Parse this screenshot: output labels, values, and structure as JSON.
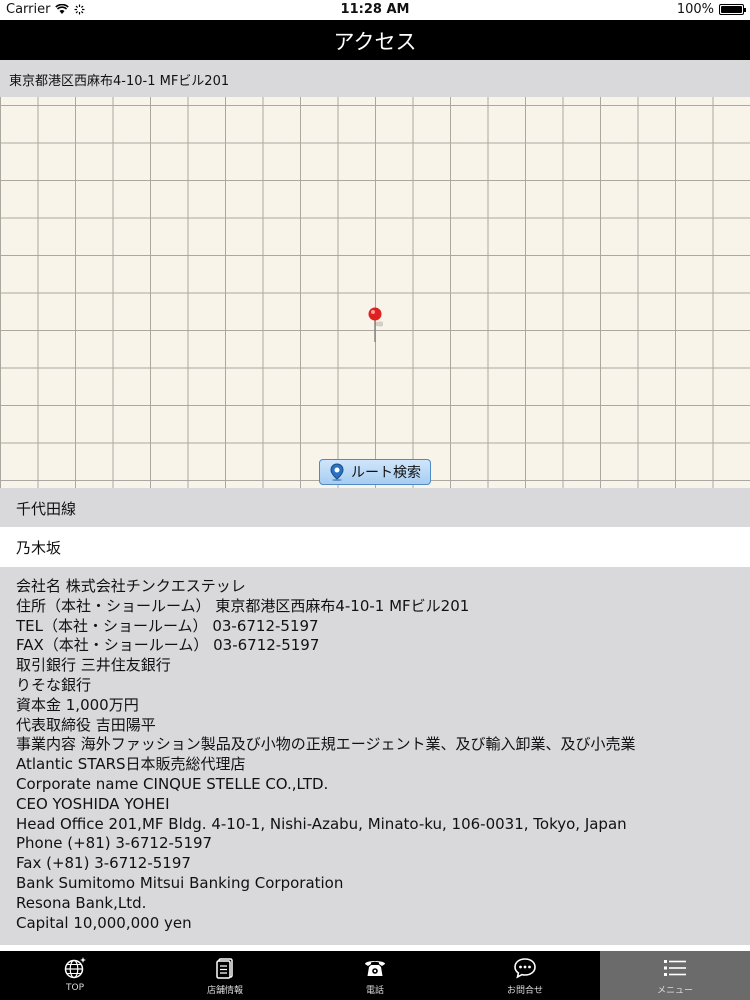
{
  "status_bar": {
    "carrier": "Carrier",
    "time": "11:28 AM",
    "battery": "100%",
    "battery_level": 1.0
  },
  "nav": {
    "title": "アクセス"
  },
  "address": {
    "text": "東京都港区西麻布4-10-1 MFビル201"
  },
  "map": {
    "route_button": "ルート検索"
  },
  "route": {
    "line": "千代田線",
    "station": "乃木坂"
  },
  "info_lines": [
    "会社名 株式会社チンクエステッレ",
    "住所（本社・ショールーム） 東京都港区西麻布4-10-1 MFビル201",
    "TEL（本社・ショールーム） 03-6712-5197",
    "FAX（本社・ショールーム） 03-6712-5197",
    "取引銀行 三井住友銀行",
    "りそな銀行",
    "資本金 1,000万円",
    "代表取締役 吉田陽平",
    "事業内容 海外ファッション製品及び小物の正規エージェント業、及び輸入卸業、及び小売業",
    "Atlantic STARS日本販売総代理店",
    "Corporate name CINQUE STELLE CO.,LTD.",
    "CEO YOSHIDA YOHEI",
    "Head Office 201,MF Bldg. 4-10-1, Nishi-Azabu, Minato-ku, 106-0031, Tokyo, Japan",
    "Phone (+81) 3-6712-5197",
    "Fax (+81) 3-6712-5197",
    "Bank Sumitomo Mitsui Banking Corporation",
    "Resona Bank,Ltd.",
    "Capital 10,000,000 yen"
  ],
  "tabs": [
    {
      "label": "TOP",
      "icon": "globe-icon"
    },
    {
      "label": "店舗情報",
      "icon": "document-icon"
    },
    {
      "label": "電話",
      "icon": "phone-icon"
    },
    {
      "label": "お問合せ",
      "icon": "chat-icon"
    },
    {
      "label": "メニュー",
      "icon": "list-icon",
      "active": true
    }
  ],
  "colors": {
    "nav_bg": "#000000",
    "section_bg": "#d9d9dc",
    "map_bg": "#f8f4ea",
    "pin": "#e02020",
    "route_button": "#a7cdf1"
  }
}
